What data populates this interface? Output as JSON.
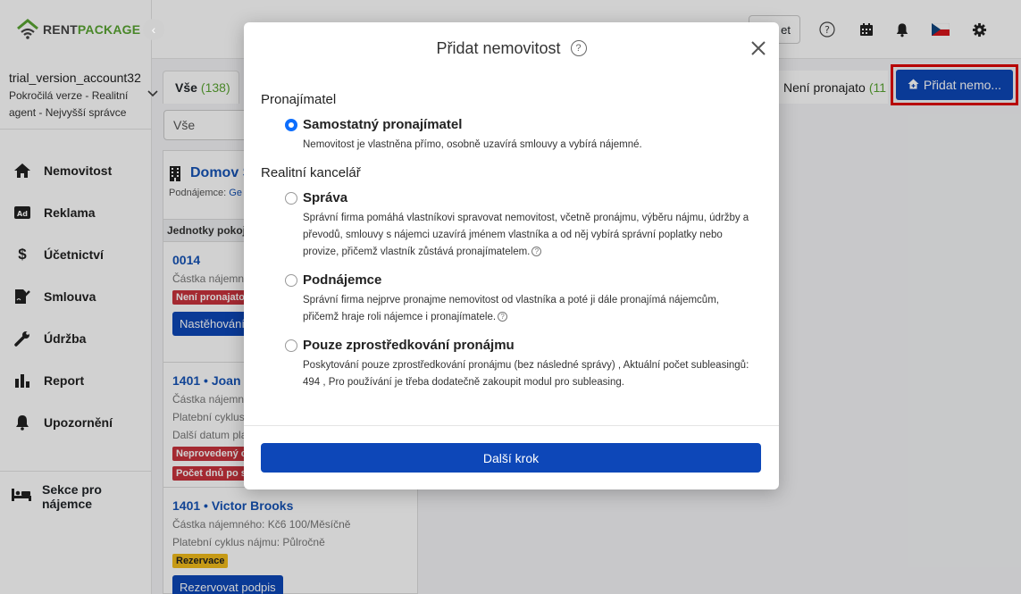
{
  "app": {
    "logo_part1": "RENT",
    "logo_part2": "PACKAGE",
    "account_name": "trial_version_account32",
    "account_role": "Pokročilá verze - Realitní agent - Nejvyšší správce"
  },
  "nav": {
    "items": [
      {
        "label": "Nemovitost",
        "icon": "home-icon"
      },
      {
        "label": "Reklama",
        "icon": "ad-icon"
      },
      {
        "label": "Účetnictví",
        "icon": "dollar-icon"
      },
      {
        "label": "Smlouva",
        "icon": "contract-icon"
      },
      {
        "label": "Údržba",
        "icon": "wrench-icon"
      },
      {
        "label": "Report",
        "icon": "chart-icon"
      },
      {
        "label": "Upozornění",
        "icon": "bell-icon"
      }
    ],
    "tenant_section": "Sekce pro nájemce"
  },
  "topbar": {
    "partial_button": "et"
  },
  "tabs": {
    "all_label": "Vše",
    "all_count": "(138)",
    "unrented_label": "Není pronajato",
    "unrented_count": "(11",
    "add_button": "Přidat nemo..."
  },
  "filter": {
    "value": "Vše"
  },
  "list": {
    "property_title": "Domov S",
    "property_sub_label": "Podnájemce:",
    "property_sub_value": "Ge",
    "units_header": "Jednotky pokoj",
    "units": [
      {
        "title": "0014",
        "line1": "Částka nájemné",
        "badge": "Není pronajato",
        "button": "Nastěhování/"
      },
      {
        "title": "1401 • Joan R",
        "line1": "Částka nájemné",
        "line2": "Platební cyklus",
        "line3": "Další datum pla",
        "badge": "Neprovedený o",
        "badge2": "Počet dnů po sp"
      },
      {
        "title": "1401 • Victor Brooks",
        "line1": "Částka nájemného: Kč6 100/Měsíčně",
        "line2": "Platební cyklus nájmu: Půlročně",
        "badge": "Rezervace",
        "button": "Rezervovat podpis"
      }
    ]
  },
  "modal": {
    "title": "Přidat nemovitost",
    "help": "?",
    "section1": "Pronajímatel",
    "section2": "Realitní kancelář",
    "options": [
      {
        "title": "Samostatný pronajímatel",
        "desc": "Nemovitost je vlastněna přímo, osobně uzavírá smlouvy a vybírá nájemné.",
        "checked": true
      },
      {
        "title": "Správa",
        "desc": "Správní firma pomáhá vlastníkovi spravovat nemovitost, včetně pronájmu, výběru nájmu, údržby a převodů, smlouvy s nájemci uzavírá jménem vlastníka a od něj vybírá správní poplatky nebo provize, přičemž vlastník zůstává pronajímatelem.",
        "checked": false
      },
      {
        "title": "Podnájemce",
        "desc": "Správní firma nejprve pronajme nemovitost od vlastníka a poté ji dále pronajímá nájemcům, přičemž hraje roli nájemce i pronajímatele.",
        "checked": false
      },
      {
        "title": "Pouze zprostředkování pronájmu",
        "desc": "Poskytování pouze zprostředkování pronájmu (bez následné správy) , Aktuální počet subleasingů: 494 , Pro používání je třeba dodatečně zakoupit modul pro subleasing.",
        "checked": false
      }
    ],
    "next_button": "Další krok"
  }
}
